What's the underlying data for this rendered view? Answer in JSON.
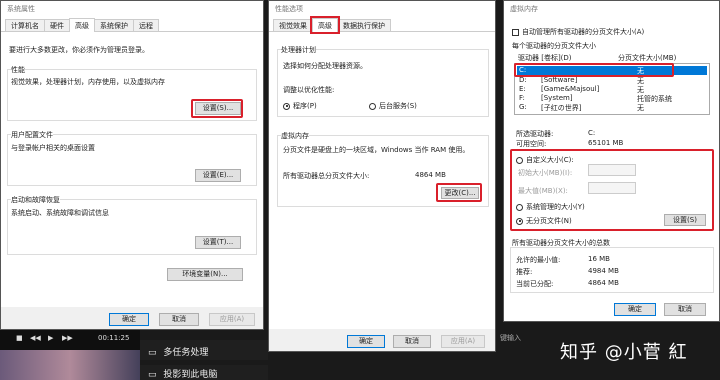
{
  "sysprop": {
    "title": "系统属性",
    "tabs": [
      "计算机名",
      "硬件",
      "高级",
      "系统保护",
      "远程"
    ],
    "admin_note": "要进行大多数更改，你必须作为管理员登录。",
    "perf_title": "性能",
    "perf_desc": "视觉效果，处理器计划，内存使用，以及虚拟内存",
    "perf_btn": "设置(S)...",
    "profile_title": "用户配置文件",
    "profile_desc": "与登录帐户相关的桌面设置",
    "profile_btn": "设置(E)...",
    "startup_title": "启动和故障恢复",
    "startup_desc": "系统启动、系统故障和调试信息",
    "startup_btn": "设置(T)...",
    "env_btn": "环境变量(N)...",
    "ok": "确定",
    "cancel": "取消",
    "apply": "应用(A)"
  },
  "perfopt": {
    "title": "性能选项",
    "tabs": [
      "视觉效果",
      "高级",
      "数据执行保护"
    ],
    "sched_title": "处理器计划",
    "sched_desc": "选择如何分配处理器资源。",
    "adjust_label": "调整以优化性能:",
    "opt_program": "程序(P)",
    "opt_background": "后台服务(S)",
    "vm_title": "虚拟内存",
    "vm_desc": "分页文件是硬盘上的一块区域，Windows 当作 RAM 使用。",
    "vm_total_label": "所有驱动器总分页文件大小:",
    "vm_total_value": "4864 MB",
    "vm_change_btn": "更改(C)...",
    "ok": "确定",
    "cancel": "取消",
    "apply": "应用(A)"
  },
  "vmem": {
    "title": "虚拟内存",
    "auto_manage": "自动管理所有驱动器的分页文件大小(A)",
    "per_drive_title": "每个驱动器的分页文件大小",
    "col_drive": "驱动器 [卷标](D)",
    "col_size": "分页文件大小(MB)",
    "drives": [
      {
        "drive": "C:",
        "label": "",
        "size": "无"
      },
      {
        "drive": "D:",
        "label": "[Software]",
        "size": "无"
      },
      {
        "drive": "E:",
        "label": "[Game&Majsoul]",
        "size": "无"
      },
      {
        "drive": "F:",
        "label": "[System]",
        "size": "托管的系统"
      },
      {
        "drive": "G:",
        "label": "[子红の世界]",
        "size": "无"
      }
    ],
    "sel_drive_label": "所选驱动器:",
    "sel_drive_value": "C:",
    "free_label": "可用空间:",
    "free_value": "65101 MB",
    "custom_size": "自定义大小(C):",
    "initial_label": "初始大小(MB)(I):",
    "max_label": "最大值(MB)(X):",
    "system_managed": "系统管理的大小(Y)",
    "no_paging": "无分页文件(N)",
    "set_btn": "设置(S)",
    "total_title": "所有驱动器分页文件大小的总数",
    "min_label": "允许的最小值:",
    "min_value": "16 MB",
    "rec_label": "推荐:",
    "rec_value": "4984 MB",
    "cur_label": "当前已分配:",
    "cur_value": "4864 MB",
    "ok": "确定",
    "cancel": "取消"
  },
  "background": {
    "time": "00:11:25",
    "multitask": "多任务处理",
    "project": "投影到此电脑",
    "ime_hint": "键输入"
  },
  "watermark": "知乎 @小菅 紅",
  "colors": {
    "highlight": "#d9202b",
    "selection": "#0078d7"
  }
}
